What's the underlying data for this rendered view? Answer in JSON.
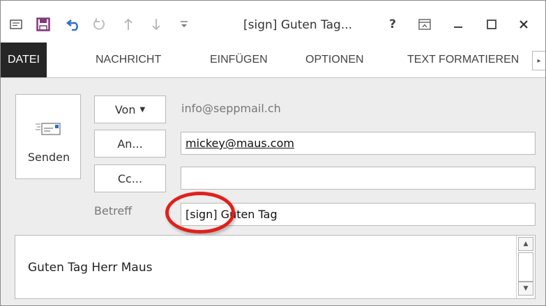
{
  "titlebar": {
    "title": "[sign] Guten Tag...",
    "help_glyph": "?",
    "icons": [
      "app-menu-icon",
      "save-icon",
      "undo-icon",
      "redo-icon",
      "up-arrow-icon",
      "down-arrow-icon",
      "customize-qat-icon",
      "ribbon-display-icon",
      "minimize-icon",
      "maximize-icon",
      "close-icon"
    ]
  },
  "ribbon": {
    "tabs": [
      {
        "label": "DATEI"
      },
      {
        "label": "NACHRICHT"
      },
      {
        "label": "EINFÜGEN"
      },
      {
        "label": "OPTIONEN"
      },
      {
        "label": "TEXT FORMATIEREN"
      }
    ],
    "scroll_glyph": "▸"
  },
  "compose": {
    "send_label": "Senden",
    "from_label": "Von",
    "from_value": "info@seppmail.ch",
    "to_label": "An...",
    "to_value": "mickey@maus.com",
    "cc_label": "Cc...",
    "cc_value": "",
    "subject_label": "Betreff",
    "subject_value": "[sign] Guten Tag"
  },
  "body": {
    "text": "Guten Tag Herr Maus"
  },
  "colors": {
    "accent_purple": "#7b3f9e",
    "save_purple": "#80397b",
    "undo_blue": "#2e6fc4",
    "active_tab_bg": "#262626",
    "highlight_red": "#e0201c"
  }
}
